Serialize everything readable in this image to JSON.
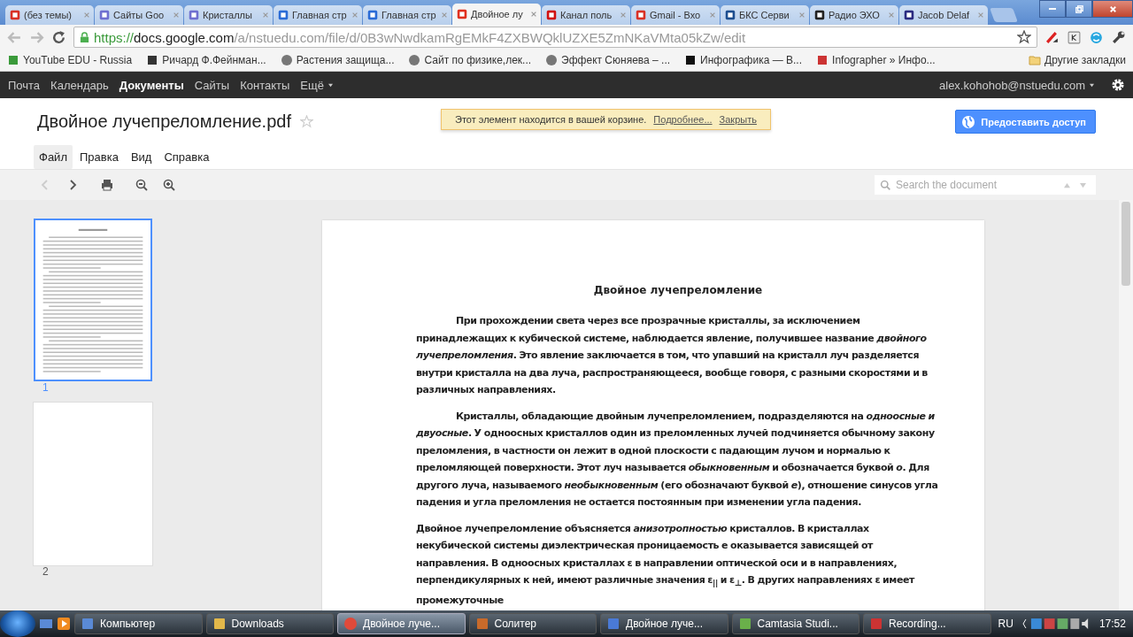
{
  "browser": {
    "tabs": [
      {
        "label": "(без темы)",
        "selected": false
      },
      {
        "label": "Сайты Goo",
        "selected": false
      },
      {
        "label": "Кристаллы",
        "selected": false
      },
      {
        "label": "Главная стр",
        "selected": false
      },
      {
        "label": "Главная стр",
        "selected": false
      },
      {
        "label": "Двойное лу",
        "selected": true
      },
      {
        "label": "Канал поль",
        "selected": false
      },
      {
        "label": "Gmail - Вхо",
        "selected": false
      },
      {
        "label": "БКС Серви",
        "selected": false
      },
      {
        "label": "Радио ЭХО",
        "selected": false
      },
      {
        "label": "Jacob Delaf",
        "selected": false
      }
    ],
    "url": {
      "scheme": "https://",
      "host": "docs.google.com",
      "path": "/a/nstuedu.com/file/d/0B3wNwdkamRgEMkF4ZXBWQklUZXE5ZmNKaVMta05kZw/edit"
    },
    "bookmarks": [
      {
        "label": "YouTube EDU - Russia"
      },
      {
        "label": "Ричард Ф.Фейнман..."
      },
      {
        "label": "Растения защища..."
      },
      {
        "label": "Сайт по физике,лек..."
      },
      {
        "label": "Эффект Сюняева – ..."
      },
      {
        "label": "Инфографика — В..."
      },
      {
        "label": "Infographer » Инфо..."
      }
    ],
    "other_bookmarks": "Другие закладки"
  },
  "google_bar": {
    "links": [
      {
        "label": "Почта",
        "selected": false
      },
      {
        "label": "Календарь",
        "selected": false
      },
      {
        "label": "Документы",
        "selected": true
      },
      {
        "label": "Сайты",
        "selected": false
      },
      {
        "label": "Контакты",
        "selected": false
      },
      {
        "label": "Ещё",
        "selected": false
      }
    ],
    "account": "alex.kohohob@nstuedu.com"
  },
  "header": {
    "title": "Двойное лучепреломление.pdf",
    "starred": false,
    "notice": {
      "text": "Этот элемент находится в вашей корзине.",
      "links": [
        "Подробнее...",
        "Закрыть"
      ]
    },
    "share_button": "Предоставить доступ",
    "menu": [
      {
        "label": "Файл",
        "selected": true
      },
      {
        "label": "Правка",
        "selected": false
      },
      {
        "label": "Вид",
        "selected": false
      },
      {
        "label": "Справка",
        "selected": false
      }
    ]
  },
  "toolbar": {
    "search": {
      "placeholder": "Search the document"
    }
  },
  "thumbnails": [
    {
      "label": "1",
      "selected": true
    },
    {
      "label": "2",
      "selected": false
    }
  ],
  "document": {
    "heading": "Двойное лучепреломление",
    "paragraphs": [
      {
        "indent": true,
        "text": "При прохождении света через все прозрачные кристаллы, за исключением принадлежащих к кубической системе, наблюдается явление, получившее название  *двойного лучепреломления*. Это явление заключается в том, что упавший на кристалл луч разделяется внутри кристалла на два луча, распространяющееся, вообще говоря, с разными скоростями и в различных направлениях."
      },
      {
        "indent": true,
        "text": "Кристаллы, обладающие двойным лучепреломлением, подразделяются на *одноосные и двуосные*. У одноосных кристаллов один из преломленных лучей  подчиняется обычному закону преломления, в частности он лежит в одной плоскости с падающим лучом и нормалью к преломляющей поверхности. Этот луч называется *обыкновенным* и обозначается буквой *о*. Для другого луча, называемого *необыкновенным* (его обозначают буквой *е*), отношение синусов угла падения и угла преломления не остается  постоянным при изменении угла падения."
      },
      {
        "indent": false,
        "text": "Двойное лучепреломление объясняется *анизотропностью* кристаллов. В кристаллах некубической системы диэлектрическая проницаемость е оказывается зависящей от направления. В одноосных кристаллах  ε  в направлении оптической оси и в направлениях, перпендикулярных к ней, имеют различные значения   ε$_{||}$ и ε$_{⊥}$. В других направлениях  ε имеет промежуточные"
      }
    ]
  },
  "taskbar": {
    "items": [
      {
        "label": "Компьютер",
        "selected": false
      },
      {
        "label": "Downloads",
        "selected": false
      },
      {
        "label": "Двойное луче...",
        "selected": true
      },
      {
        "label": "Солитер",
        "selected": false
      },
      {
        "label": "Двойное луче...",
        "selected": false
      },
      {
        "label": "Camtasia Studi...",
        "selected": false
      },
      {
        "label": "Recording...",
        "selected": false
      }
    ],
    "language": "RU",
    "clock": "17:52"
  }
}
